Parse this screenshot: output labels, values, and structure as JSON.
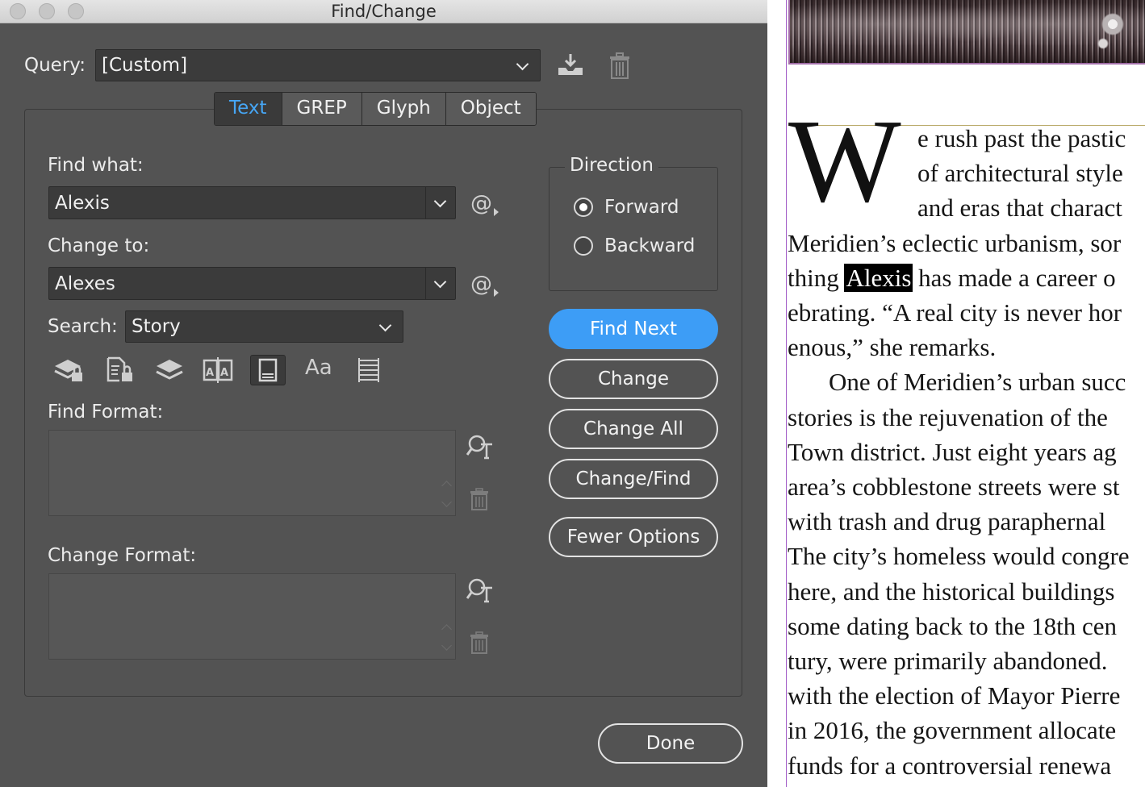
{
  "window": {
    "title": "Find/Change"
  },
  "query": {
    "label": "Query:",
    "value": "[Custom]"
  },
  "tabs": [
    {
      "label": "Text",
      "active": true
    },
    {
      "label": "GREP",
      "active": false
    },
    {
      "label": "Glyph",
      "active": false
    },
    {
      "label": "Object",
      "active": false
    }
  ],
  "find": {
    "label": "Find what:",
    "value": "Alexis"
  },
  "change": {
    "label": "Change to:",
    "value": "Alexes"
  },
  "search": {
    "label": "Search:",
    "value": "Story"
  },
  "direction": {
    "title": "Direction",
    "options": [
      {
        "label": "Forward",
        "selected": true
      },
      {
        "label": "Backward",
        "selected": false
      }
    ]
  },
  "buttons": {
    "find_next": "Find Next",
    "change": "Change",
    "change_all": "Change All",
    "change_find": "Change/Find",
    "fewer_options": "Fewer Options",
    "done": "Done"
  },
  "search_options": {
    "case_glyph": "Aa",
    "icons": [
      "locked-layers-icon",
      "locked-stories-icon",
      "hidden-layers-icon",
      "master-pages-icon",
      "footnotes-icon",
      "case-sensitive-icon",
      "whole-word-icon"
    ]
  },
  "find_format": {
    "label": "Find Format:"
  },
  "change_format": {
    "label": "Change Format:"
  },
  "colors": {
    "accent": "#3d9df6",
    "tab_active": "#46a6f5",
    "dialog_bg": "#535353"
  },
  "document": {
    "dropcap": "W",
    "lines": [
      "e rush past the pastic",
      "of architectural style",
      "and eras that charact",
      "Meridien’s eclectic urbanism, sor",
      {
        "before": "thing ",
        "highlight": "Alexis",
        "after": " has made a career o"
      },
      "ebrating. “A real city is never hor",
      "enous,” she remarks.",
      "One of Meridien’s urban succ",
      "stories is the rejuvenation of the",
      "Town district. Just eight years ag",
      "area’s cobblestone streets were st",
      "with trash and drug paraphernal",
      "The city’s homeless would congre",
      "here, and the historical buildings",
      "some dating back to the 18th cen",
      "tury, were primarily abandoned.",
      "with the election of Mayor Pierre",
      "in 2016, the government allocate",
      "funds for a controversial renewa"
    ]
  }
}
